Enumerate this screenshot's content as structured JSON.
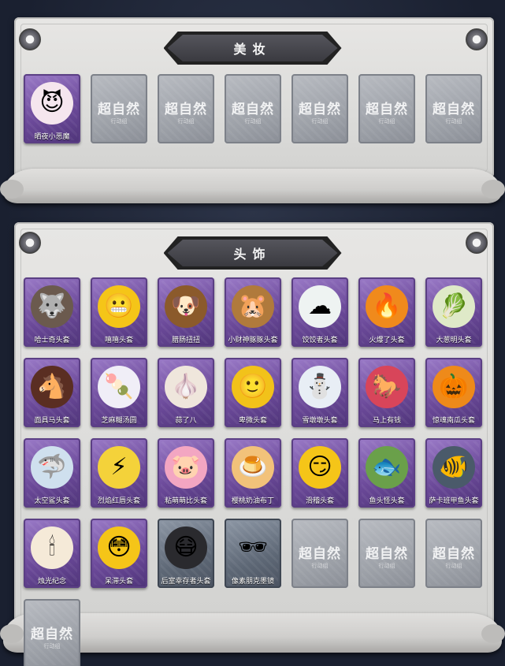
{
  "makeup": {
    "title": "美妆",
    "items": [
      {
        "label": "晒夜小恶魔",
        "icon": "devil-doll-icon",
        "glyph": "😈",
        "state": "owned",
        "bg": "#f5e6ee"
      }
    ],
    "locked_count": 6,
    "watermark": "超自然",
    "watermark_sub": "行动组"
  },
  "headwear": {
    "title": "头饰",
    "items": [
      {
        "label": "哈士奇头套",
        "icon": "husky-head-icon",
        "glyph": "🐺",
        "bg": "#6b5a4e"
      },
      {
        "label": "嘻嘻头套",
        "icon": "grin-emoji-icon",
        "glyph": "😬",
        "bg": "#f5c518"
      },
      {
        "label": "腊肠扭扭",
        "icon": "dachshund-head-icon",
        "glyph": "🐶",
        "bg": "#8b5a2b"
      },
      {
        "label": "小财神豚豚头套",
        "icon": "capybara-head-icon",
        "glyph": "🐹",
        "bg": "#b07a3c"
      },
      {
        "label": "饺饺者头套",
        "icon": "cloud-mascot-icon",
        "glyph": "☁",
        "bg": "#eef3f2"
      },
      {
        "label": "火爆了头套",
        "icon": "fire-spirit-icon",
        "glyph": "🔥",
        "bg": "#f08a1c"
      },
      {
        "label": "大葱明头套",
        "icon": "scallion-head-icon",
        "glyph": "🥬",
        "bg": "#dfe9c8"
      },
      {
        "label": "面具马头套",
        "icon": "horse-head-icon",
        "glyph": "🐴",
        "bg": "#5a2e22"
      },
      {
        "label": "芝麻糊汤圆",
        "icon": "dumpling-icon",
        "glyph": "🍡",
        "bg": "#f0eef7"
      },
      {
        "label": "蒜了八",
        "icon": "garlic-icon",
        "glyph": "🧄",
        "bg": "#efe6dc"
      },
      {
        "label": "卑微头套",
        "icon": "shy-emoji-icon",
        "glyph": "🙂",
        "bg": "#f2c21a"
      },
      {
        "label": "雪墩墩头套",
        "icon": "snowman-head-icon",
        "glyph": "⛄",
        "bg": "#e8eef5"
      },
      {
        "label": "马上有钱",
        "icon": "red-horse-icon",
        "glyph": "🐎",
        "bg": "#d8455a"
      },
      {
        "label": "惊魂南瓜头套",
        "icon": "pumpkin-head-icon",
        "glyph": "🎃",
        "bg": "#ee8a1a"
      },
      {
        "label": "太空鲨头套",
        "icon": "shark-head-icon",
        "glyph": "🦈",
        "bg": "#cfe0ee"
      },
      {
        "label": "烈焰红唇头套",
        "icon": "pikachu-head-icon",
        "glyph": "⚡",
        "bg": "#f4d23a"
      },
      {
        "label": "粘萌萌比头套",
        "icon": "pink-pig-icon",
        "glyph": "🐷",
        "bg": "#f3a6c2"
      },
      {
        "label": "樱桃奶油布丁",
        "icon": "pudding-icon",
        "glyph": "🍮",
        "bg": "#f2c27a"
      },
      {
        "label": "滑稽头套",
        "icon": "smirk-emoji-icon",
        "glyph": "😏",
        "bg": "#f5c518"
      },
      {
        "label": "鱼头怪头套",
        "icon": "fish-monster-icon",
        "glyph": "🐟",
        "bg": "#6aa04a"
      },
      {
        "label": "萨卡班甲鱼头套",
        "icon": "sacabambaspis-icon",
        "glyph": "🐠",
        "bg": "#4a5a6a"
      },
      {
        "label": "烛光纪念",
        "icon": "candle-icon",
        "glyph": "🕯",
        "bg": "#f5ead8"
      },
      {
        "label": "呆滞头套",
        "icon": "stunned-emoji-icon",
        "glyph": "😳",
        "bg": "#f5c518"
      },
      {
        "label": "后室幸存者头套",
        "icon": "gas-mask-icon",
        "glyph": "😷",
        "bg": "#2a2a2e",
        "card": "gray"
      },
      {
        "label": "像素朋克墨镜",
        "icon": "pixel-sunglasses-icon",
        "glyph": "🕶",
        "bg": "transparent",
        "card": "gray"
      }
    ],
    "locked_count": 4,
    "watermark": "超自然",
    "watermark_sub": "行动组"
  }
}
